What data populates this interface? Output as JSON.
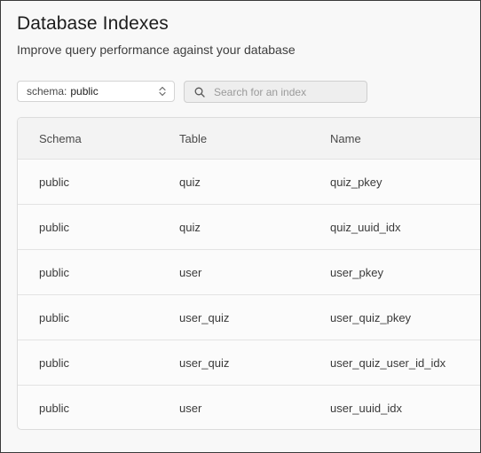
{
  "header": {
    "title": "Database Indexes",
    "subtitle": "Improve query performance against your database"
  },
  "toolbar": {
    "schema_prefix": "schema:",
    "schema_value": "public",
    "search_placeholder": "Search for an index"
  },
  "table": {
    "columns": [
      "Schema",
      "Table",
      "Name"
    ],
    "rows": [
      [
        "public",
        "quiz",
        "quiz_pkey"
      ],
      [
        "public",
        "quiz",
        "quiz_uuid_idx"
      ],
      [
        "public",
        "user",
        "user_pkey"
      ],
      [
        "public",
        "user_quiz",
        "user_quiz_pkey"
      ],
      [
        "public",
        "user_quiz",
        "user_quiz_user_id_idx"
      ],
      [
        "public",
        "user",
        "user_uuid_idx"
      ]
    ]
  },
  "colors": {
    "background": "#f8f8f8",
    "text": "#1c1c1c",
    "border": "#dcdcdc",
    "search_bg": "#eeeeee"
  },
  "icons": {
    "schema_select": "chevron-up-down-icon",
    "search": "search-icon"
  }
}
